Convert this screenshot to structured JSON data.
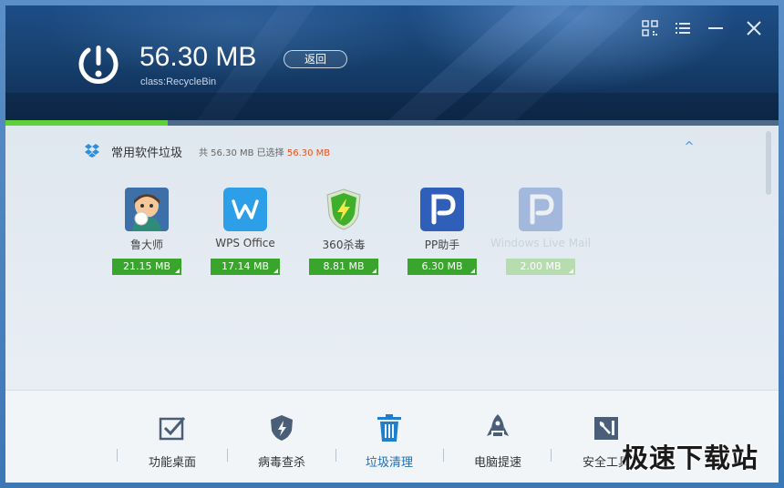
{
  "header": {
    "size": "56.30 MB",
    "back_label": "返回",
    "class_label": "class:RecycleBin"
  },
  "progress": {
    "fraction": 0.21
  },
  "category": {
    "title": "常用软件垃圾",
    "summary_prefix": "共 56.30 MB 已选择",
    "selected": "56.30 MB",
    "collapse_glyph": "^"
  },
  "apps": [
    {
      "name": "鲁大师",
      "size": "21.15 MB",
      "selected": true
    },
    {
      "name": "WPS Office",
      "size": "17.14 MB",
      "selected": true
    },
    {
      "name": "360杀毒",
      "size": "8.81 MB",
      "selected": true
    },
    {
      "name": "PP助手",
      "size": "6.30 MB",
      "selected": true
    },
    {
      "name": "Windows Live Mail",
      "size": "2.00 MB",
      "selected": false
    }
  ],
  "nav": [
    {
      "label": "功能桌面",
      "icon": "checkbox-icon"
    },
    {
      "label": "病毒查杀",
      "icon": "shield-icon"
    },
    {
      "label": "垃圾清理",
      "icon": "trash-icon",
      "active": true
    },
    {
      "label": "电脑提速",
      "icon": "rocket-icon"
    },
    {
      "label": "安全工具",
      "icon": "tools-icon"
    }
  ],
  "watermark": "极速下载站",
  "colors": {
    "accent_green": "#3aa52c",
    "accent_blue": "#1f6db5",
    "selected_red": "#e8531b"
  }
}
